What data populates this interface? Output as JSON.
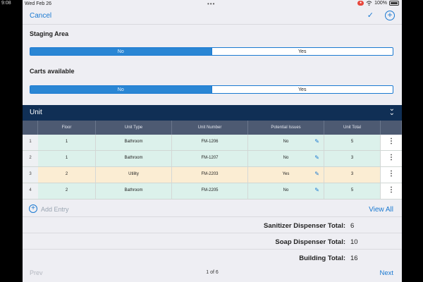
{
  "status_bar": {
    "time": "9:08",
    "date": "Wed Feb 26",
    "dots": "•••",
    "battery": "100%"
  },
  "nav": {
    "cancel": "Cancel",
    "confirm_icon": "✓",
    "add_icon": "+"
  },
  "staging_area": {
    "label": "Staging Area",
    "options": [
      "No",
      "Yes"
    ],
    "selected": "No"
  },
  "carts_available": {
    "label": "Carts available",
    "options": [
      "No",
      "Yes"
    ],
    "selected": "No"
  },
  "unit": {
    "title": "Unit",
    "collapse_icon": "chevron-double-down",
    "columns": [
      "Floor",
      "Unit Type",
      "Unit Number",
      "Potential Issues",
      "Unit Total"
    ],
    "rows": [
      {
        "index": "1",
        "floor": "1",
        "unit_type": "Bathroom",
        "unit_number": "FM-1206",
        "potential_issues": "No",
        "unit_total": "5",
        "color": "green"
      },
      {
        "index": "2",
        "floor": "1",
        "unit_type": "Bathroom",
        "unit_number": "FM-1207",
        "potential_issues": "No",
        "unit_total": "3",
        "color": "green"
      },
      {
        "index": "3",
        "floor": "2",
        "unit_type": "Utility",
        "unit_number": "FM-2203",
        "potential_issues": "Yes",
        "unit_total": "3",
        "color": "orange"
      },
      {
        "index": "4",
        "floor": "2",
        "unit_type": "Bathroom",
        "unit_number": "FM-2205",
        "potential_issues": "No",
        "unit_total": "5",
        "color": "green"
      }
    ],
    "add_entry": "Add Entry",
    "view_all": "View All"
  },
  "totals": [
    {
      "label": "Sanitizer Dispenser Total:",
      "value": "6"
    },
    {
      "label": "Soap Dispenser Total:",
      "value": "10"
    },
    {
      "label": "Building Total:",
      "value": "16"
    }
  ],
  "footer": {
    "prev": "Prev",
    "page_info": "1 of 6",
    "next": "Next"
  },
  "colors": {
    "accent": "#1a79d1",
    "unit_header": "#102f55",
    "table_header": "#4d5a72",
    "row_green": "#dcf1eb",
    "row_orange": "#fbedd3"
  }
}
